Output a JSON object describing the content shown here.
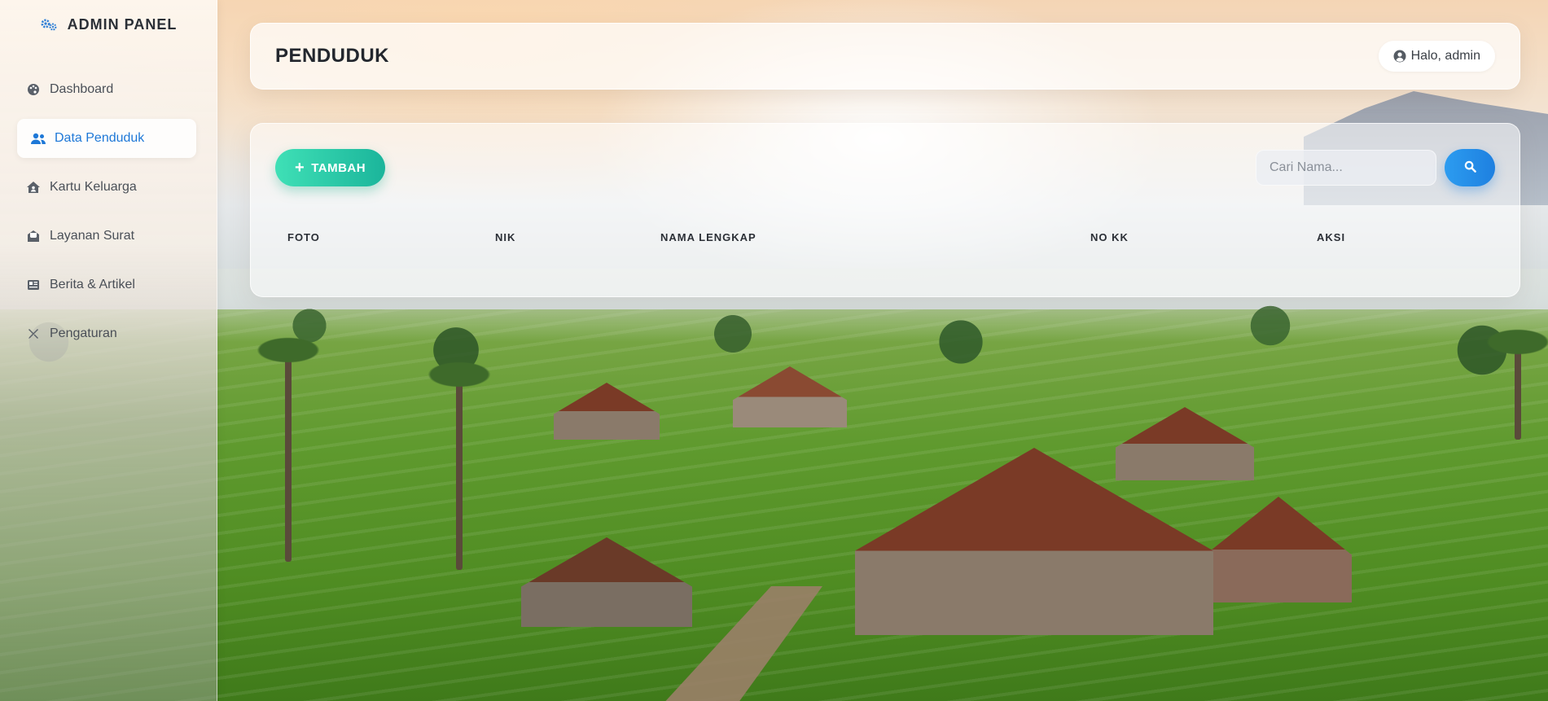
{
  "brand": {
    "title": "ADMIN PANEL",
    "icon": "gears-icon"
  },
  "sidebar": {
    "items": [
      {
        "label": "Dashboard",
        "icon": "palette-icon",
        "active": false
      },
      {
        "label": "Data Penduduk",
        "icon": "users-icon",
        "active": true
      },
      {
        "label": "Kartu Keluarga",
        "icon": "house-user-icon",
        "active": false
      },
      {
        "label": "Layanan Surat",
        "icon": "envelope-open-icon",
        "active": false
      },
      {
        "label": "Berita & Artikel",
        "icon": "newspaper-icon",
        "active": false
      },
      {
        "label": "Pengaturan",
        "icon": "tools-icon",
        "active": false
      }
    ]
  },
  "header": {
    "title": "PENDUDUK",
    "greeting": "Halo, admin",
    "greeting_icon": "user-circle-icon"
  },
  "toolbar": {
    "add_label": "TAMBAH",
    "search_placeholder": "Cari Nama...",
    "search_button_icon": "search-icon"
  },
  "table": {
    "columns": [
      "FOTO",
      "NIK",
      "NAMA LENGKAP",
      "NO KK",
      "AKSI"
    ],
    "rows": []
  },
  "colors": {
    "accent_blue": "#1e78d7",
    "add_button": "#2bc9a6",
    "search_button": "#2590e8"
  }
}
